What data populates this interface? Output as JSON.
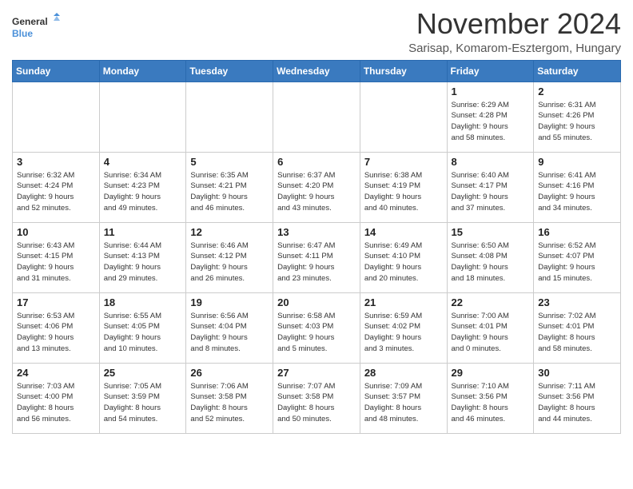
{
  "header": {
    "logo_line1": "General",
    "logo_line2": "Blue",
    "month": "November 2024",
    "location": "Sarisap, Komarom-Esztergom, Hungary"
  },
  "weekdays": [
    "Sunday",
    "Monday",
    "Tuesday",
    "Wednesday",
    "Thursday",
    "Friday",
    "Saturday"
  ],
  "weeks": [
    [
      {
        "day": "",
        "info": ""
      },
      {
        "day": "",
        "info": ""
      },
      {
        "day": "",
        "info": ""
      },
      {
        "day": "",
        "info": ""
      },
      {
        "day": "",
        "info": ""
      },
      {
        "day": "1",
        "info": "Sunrise: 6:29 AM\nSunset: 4:28 PM\nDaylight: 9 hours\nand 58 minutes."
      },
      {
        "day": "2",
        "info": "Sunrise: 6:31 AM\nSunset: 4:26 PM\nDaylight: 9 hours\nand 55 minutes."
      }
    ],
    [
      {
        "day": "3",
        "info": "Sunrise: 6:32 AM\nSunset: 4:24 PM\nDaylight: 9 hours\nand 52 minutes."
      },
      {
        "day": "4",
        "info": "Sunrise: 6:34 AM\nSunset: 4:23 PM\nDaylight: 9 hours\nand 49 minutes."
      },
      {
        "day": "5",
        "info": "Sunrise: 6:35 AM\nSunset: 4:21 PM\nDaylight: 9 hours\nand 46 minutes."
      },
      {
        "day": "6",
        "info": "Sunrise: 6:37 AM\nSunset: 4:20 PM\nDaylight: 9 hours\nand 43 minutes."
      },
      {
        "day": "7",
        "info": "Sunrise: 6:38 AM\nSunset: 4:19 PM\nDaylight: 9 hours\nand 40 minutes."
      },
      {
        "day": "8",
        "info": "Sunrise: 6:40 AM\nSunset: 4:17 PM\nDaylight: 9 hours\nand 37 minutes."
      },
      {
        "day": "9",
        "info": "Sunrise: 6:41 AM\nSunset: 4:16 PM\nDaylight: 9 hours\nand 34 minutes."
      }
    ],
    [
      {
        "day": "10",
        "info": "Sunrise: 6:43 AM\nSunset: 4:15 PM\nDaylight: 9 hours\nand 31 minutes."
      },
      {
        "day": "11",
        "info": "Sunrise: 6:44 AM\nSunset: 4:13 PM\nDaylight: 9 hours\nand 29 minutes."
      },
      {
        "day": "12",
        "info": "Sunrise: 6:46 AM\nSunset: 4:12 PM\nDaylight: 9 hours\nand 26 minutes."
      },
      {
        "day": "13",
        "info": "Sunrise: 6:47 AM\nSunset: 4:11 PM\nDaylight: 9 hours\nand 23 minutes."
      },
      {
        "day": "14",
        "info": "Sunrise: 6:49 AM\nSunset: 4:10 PM\nDaylight: 9 hours\nand 20 minutes."
      },
      {
        "day": "15",
        "info": "Sunrise: 6:50 AM\nSunset: 4:08 PM\nDaylight: 9 hours\nand 18 minutes."
      },
      {
        "day": "16",
        "info": "Sunrise: 6:52 AM\nSunset: 4:07 PM\nDaylight: 9 hours\nand 15 minutes."
      }
    ],
    [
      {
        "day": "17",
        "info": "Sunrise: 6:53 AM\nSunset: 4:06 PM\nDaylight: 9 hours\nand 13 minutes."
      },
      {
        "day": "18",
        "info": "Sunrise: 6:55 AM\nSunset: 4:05 PM\nDaylight: 9 hours\nand 10 minutes."
      },
      {
        "day": "19",
        "info": "Sunrise: 6:56 AM\nSunset: 4:04 PM\nDaylight: 9 hours\nand 8 minutes."
      },
      {
        "day": "20",
        "info": "Sunrise: 6:58 AM\nSunset: 4:03 PM\nDaylight: 9 hours\nand 5 minutes."
      },
      {
        "day": "21",
        "info": "Sunrise: 6:59 AM\nSunset: 4:02 PM\nDaylight: 9 hours\nand 3 minutes."
      },
      {
        "day": "22",
        "info": "Sunrise: 7:00 AM\nSunset: 4:01 PM\nDaylight: 9 hours\nand 0 minutes."
      },
      {
        "day": "23",
        "info": "Sunrise: 7:02 AM\nSunset: 4:01 PM\nDaylight: 8 hours\nand 58 minutes."
      }
    ],
    [
      {
        "day": "24",
        "info": "Sunrise: 7:03 AM\nSunset: 4:00 PM\nDaylight: 8 hours\nand 56 minutes."
      },
      {
        "day": "25",
        "info": "Sunrise: 7:05 AM\nSunset: 3:59 PM\nDaylight: 8 hours\nand 54 minutes."
      },
      {
        "day": "26",
        "info": "Sunrise: 7:06 AM\nSunset: 3:58 PM\nDaylight: 8 hours\nand 52 minutes."
      },
      {
        "day": "27",
        "info": "Sunrise: 7:07 AM\nSunset: 3:58 PM\nDaylight: 8 hours\nand 50 minutes."
      },
      {
        "day": "28",
        "info": "Sunrise: 7:09 AM\nSunset: 3:57 PM\nDaylight: 8 hours\nand 48 minutes."
      },
      {
        "day": "29",
        "info": "Sunrise: 7:10 AM\nSunset: 3:56 PM\nDaylight: 8 hours\nand 46 minutes."
      },
      {
        "day": "30",
        "info": "Sunrise: 7:11 AM\nSunset: 3:56 PM\nDaylight: 8 hours\nand 44 minutes."
      }
    ]
  ]
}
